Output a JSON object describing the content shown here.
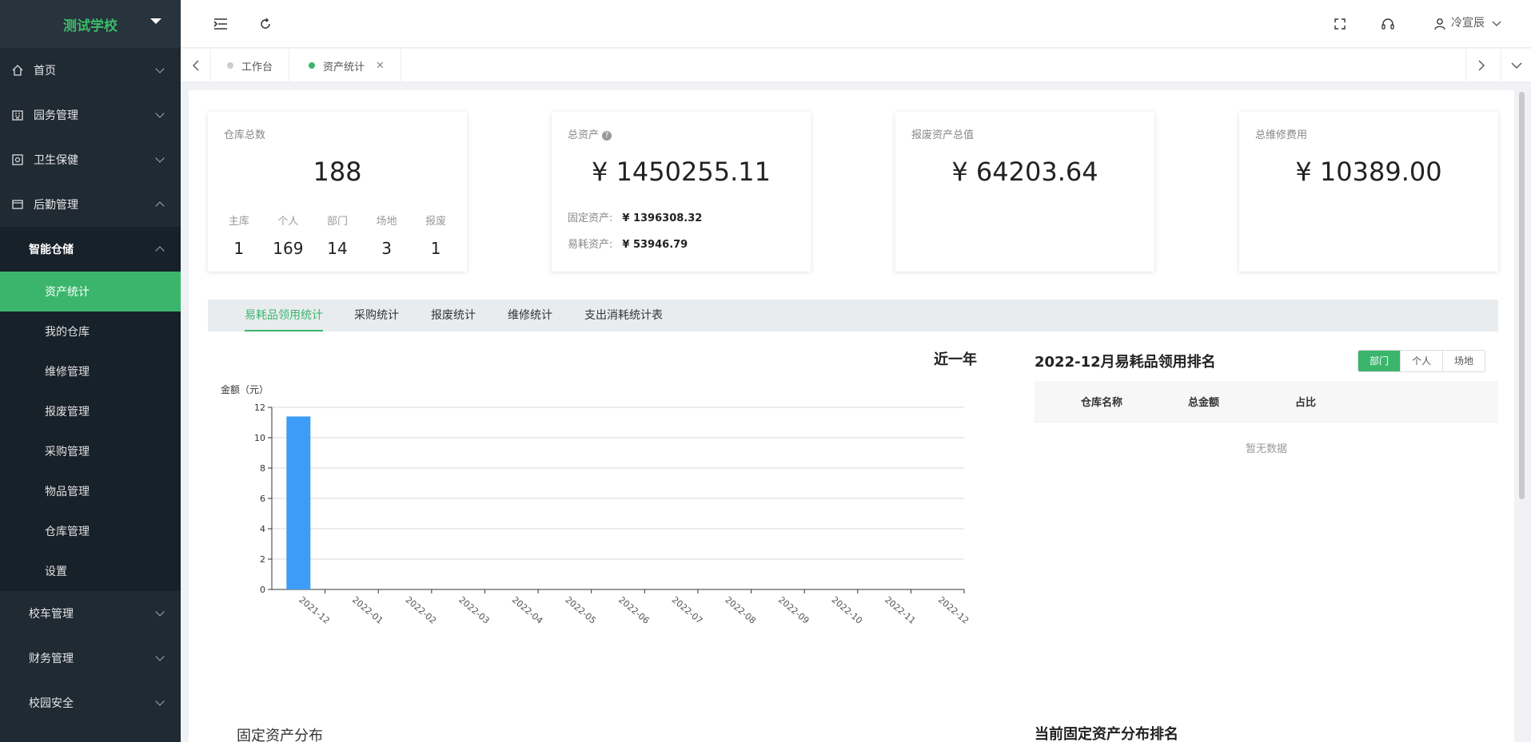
{
  "sidebar": {
    "brand": "测试学校",
    "items": [
      {
        "label": "首页"
      },
      {
        "label": "园务管理"
      },
      {
        "label": "卫生保健"
      },
      {
        "label": "后勤管理"
      }
    ],
    "submenu_head": "智能仓储",
    "sub_items": [
      "资产统计",
      "我的仓库",
      "维修管理",
      "报废管理",
      "采购管理",
      "物品管理",
      "仓库管理",
      "设置"
    ],
    "lower_items": [
      "校车管理",
      "财务管理",
      "校园安全"
    ]
  },
  "header": {
    "user": "冷宣辰"
  },
  "tabs": [
    {
      "label": "工作台"
    },
    {
      "label": "资产统计"
    }
  ],
  "cards": {
    "warehouse": {
      "title": "仓库总数",
      "value": "188",
      "breakdown": [
        {
          "label": "主库",
          "value": "1"
        },
        {
          "label": "个人",
          "value": "169"
        },
        {
          "label": "部门",
          "value": "14"
        },
        {
          "label": "场地",
          "value": "3"
        },
        {
          "label": "报废",
          "value": "1"
        }
      ]
    },
    "total_assets": {
      "title": "总资产",
      "value": "¥ 1450255.11",
      "fixed_label": "固定资产:",
      "fixed_value": "¥ 1396308.32",
      "consumable_label": "易耗资产:",
      "consumable_value": "¥ 53946.79"
    },
    "scrap": {
      "title": "报废资产总值",
      "value": "¥ 64203.64"
    },
    "repair": {
      "title": "总维修费用",
      "value": "¥ 10389.00"
    }
  },
  "stat_tabs": [
    "易耗品领用统计",
    "采购统计",
    "报废统计",
    "维修统计",
    "支出消耗统计表"
  ],
  "period": "近一年",
  "chart_data": {
    "type": "bar",
    "ylabel": "金额（元）",
    "ylim": [
      0,
      12
    ],
    "yticks": [
      0,
      2,
      4,
      6,
      8,
      10,
      12
    ],
    "categories": [
      "2021-12",
      "2022-01",
      "2022-02",
      "2022-03",
      "2022-04",
      "2022-05",
      "2022-06",
      "2022-07",
      "2022-08",
      "2022-09",
      "2022-10",
      "2022-11",
      "2022-12"
    ],
    "values": [
      11.4,
      0,
      0,
      0,
      0,
      0,
      0,
      0,
      0,
      0,
      0,
      0,
      0
    ],
    "color": "#3d9cf8",
    "grid": true
  },
  "ranking": {
    "title": "2022-12月易耗品领用排名",
    "segments": [
      "部门",
      "个人",
      "场地"
    ],
    "columns": [
      "仓库名称",
      "总金额",
      "占比"
    ],
    "empty_text": "暂无数据"
  },
  "bottom": {
    "left_title": "固定资产分布",
    "right_title": "当前固定资产分布排名"
  },
  "colors": {
    "accent": "#3bb56c",
    "sidebar_bg": "#1f2a33"
  }
}
